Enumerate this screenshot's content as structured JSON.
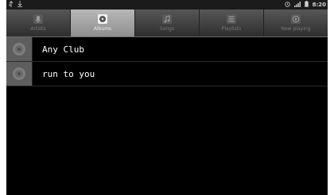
{
  "status_bar": {
    "left_icons": [
      "usb-icon",
      "download-icon"
    ],
    "right_icons": [
      "alarm-icon",
      "signal-icon",
      "battery-icon"
    ],
    "time": "8:20"
  },
  "tabs": [
    {
      "label": "Artists",
      "icon": "microphone-icon",
      "active": false
    },
    {
      "label": "Albums",
      "icon": "album-icon",
      "active": true
    },
    {
      "label": "Songs",
      "icon": "music-note-icon",
      "active": false
    },
    {
      "label": "Playlists",
      "icon": "playlist-icon",
      "active": false
    },
    {
      "label": "Now playing",
      "icon": "now-playing-icon",
      "active": false
    }
  ],
  "albums": [
    {
      "title": "Any Club",
      "art_icon": "album-disc-icon"
    },
    {
      "title": "run to you",
      "art_icon": "album-disc-icon"
    }
  ],
  "colors": {
    "background": "#000000",
    "tab_active": "#a8a8a8",
    "tab_bar": "#3a3a3a",
    "album_art": "#5e5e5e"
  }
}
